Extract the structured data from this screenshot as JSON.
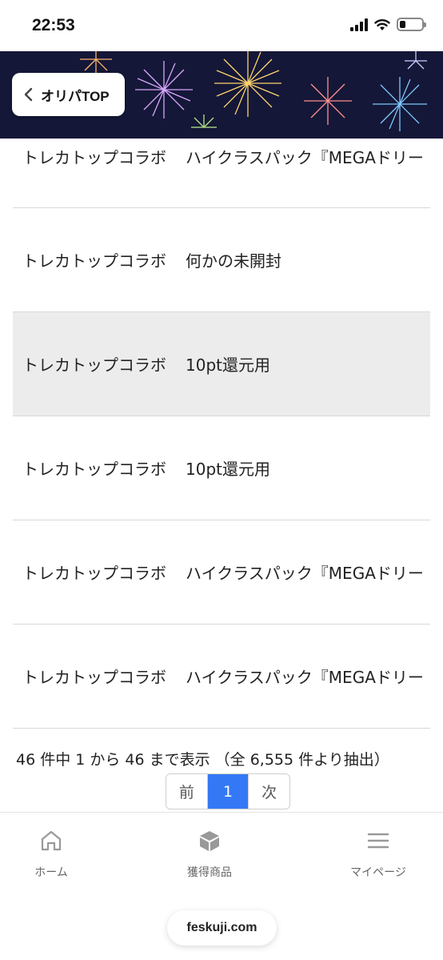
{
  "status": {
    "time": "22:53"
  },
  "header": {
    "back_label": "オリパTOP"
  },
  "rows": [
    {
      "store": "トレカトップコラボ",
      "item": "ハイクラスパック『MEGAドリー"
    },
    {
      "store": "トレカトップコラボ",
      "item": "何かの未開封"
    },
    {
      "store": "トレカトップコラボ",
      "item": "10pt還元用"
    },
    {
      "store": "トレカトップコラボ",
      "item": "10pt還元用"
    },
    {
      "store": "トレカトップコラボ",
      "item": "ハイクラスパック『MEGAドリー"
    },
    {
      "store": "トレカトップコラボ",
      "item": "ハイクラスパック『MEGAドリー"
    }
  ],
  "pagination": {
    "info": "46 件中 1 から 46 まで表示 （全 6,555 件より抽出）",
    "prev": "前",
    "current": "1",
    "next": "次"
  },
  "tabbar": {
    "home": "ホーム",
    "items": "獲得商品",
    "mypage": "マイページ"
  },
  "browser": {
    "url": "feskuji.com"
  },
  "colors": {
    "accent": "#3478f6",
    "banner_bg": "#141737",
    "highlight_row": "#ececec"
  },
  "icons": {
    "home": "home-icon",
    "items": "box-icon",
    "mypage": "menu-icon",
    "back": "chevron-left-icon"
  }
}
